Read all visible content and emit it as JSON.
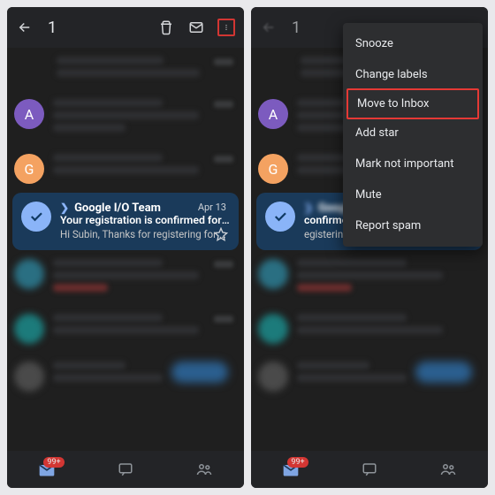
{
  "left": {
    "topbar": {
      "count": "1"
    },
    "selected": {
      "from": "Google I/O Team",
      "subject": "Your registration is confirmed for Google…",
      "preview": "Hi Subin, Thanks for registering for Google I…",
      "date": "Apr 13"
    },
    "avatars": {
      "a_letter": "A",
      "g_letter": "G"
    },
    "badge": "99+"
  },
  "right": {
    "topbar": {
      "count": "1"
    },
    "selected": {
      "subject_tail": "confirmed for Google…",
      "preview_tail": "egistering for Google I…"
    },
    "menu": {
      "items": {
        "snooze": "Snooze",
        "change_labels": "Change labels",
        "move_to_inbox": "Move to Inbox",
        "add_star": "Add star",
        "mark_not_important": "Mark not important",
        "mute": "Mute",
        "report_spam": "Report spam"
      }
    },
    "avatars": {
      "a_letter": "A",
      "g_letter": "G"
    },
    "badge": "99+"
  }
}
